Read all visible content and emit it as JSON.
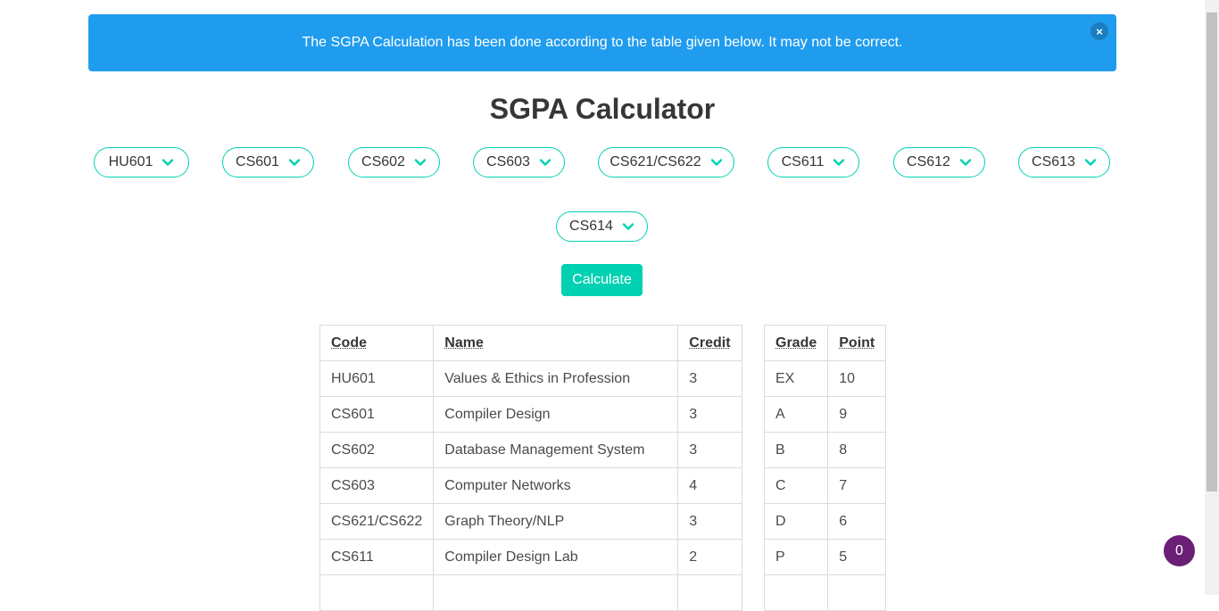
{
  "notification": {
    "message": "The SGPA Calculation has been done according to the table given below. It may not be correct.",
    "close_label": "×",
    "color": "#209cee"
  },
  "title": "SGPA Calculator",
  "subjects": [
    "HU601",
    "CS601",
    "CS602",
    "CS603",
    "CS621/CS622",
    "CS611",
    "CS612",
    "CS613",
    "CS614"
  ],
  "calculate_label": "Calculate",
  "accent": "#00d1b2",
  "course_table": {
    "headers": [
      "Code",
      "Name",
      "Credit"
    ],
    "rows": [
      [
        "HU601",
        "Values & Ethics in Profession",
        "3"
      ],
      [
        "CS601",
        "Compiler Design",
        "3"
      ],
      [
        "CS602",
        "Database Management System",
        "3"
      ],
      [
        "CS603",
        "Computer Networks",
        "4"
      ],
      [
        "CS621/CS622",
        "Graph Theory/NLP",
        "3"
      ],
      [
        "CS611",
        "Compiler Design Lab",
        "2"
      ]
    ]
  },
  "grade_table": {
    "headers": [
      "Grade",
      "Point"
    ],
    "rows": [
      [
        "EX",
        "10"
      ],
      [
        "A",
        "9"
      ],
      [
        "B",
        "8"
      ],
      [
        "C",
        "7"
      ],
      [
        "D",
        "6"
      ],
      [
        "P",
        "5"
      ]
    ]
  },
  "badge_count": "0",
  "badge_color": "#6b1f77"
}
